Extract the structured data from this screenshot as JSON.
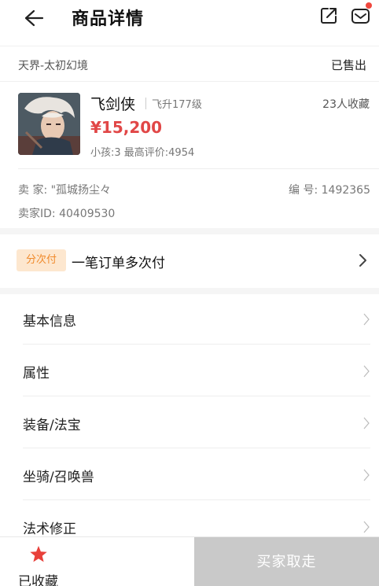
{
  "header": {
    "title": "商品详情",
    "back_icon": "arrow-left-icon",
    "share_icon": "share-icon",
    "message_icon": "message-icon"
  },
  "server": {
    "name": "天界-太初幻境",
    "status": "已售出"
  },
  "role": {
    "name": "飞剑侠",
    "level": "飞升177级",
    "favorites": "23人收藏",
    "price": "¥15,200",
    "stats": "小孩:3 最高评价:4954"
  },
  "seller": {
    "name_line": "卖 家: \"孤城扬尘々",
    "number_line": "编 号: 1492365",
    "id_line": "卖家ID: 40409530"
  },
  "installment": {
    "tag": "分次付",
    "text": "一笔订单多次付"
  },
  "menu": [
    {
      "label": "基本信息"
    },
    {
      "label": "属性"
    },
    {
      "label": "装备/法宝"
    },
    {
      "label": "坐骑/召唤兽"
    },
    {
      "label": "法术修正"
    }
  ],
  "bottom": {
    "favorite_label": "已收藏",
    "buy_label": "买家取走"
  },
  "colors": {
    "price": "#e14747",
    "tag_bg": "#fde7cf",
    "tag_text": "#f08a2b",
    "star": "#e8403a",
    "notify_dot": "#f0483e",
    "buy_disabled": "#c9c9c9"
  }
}
